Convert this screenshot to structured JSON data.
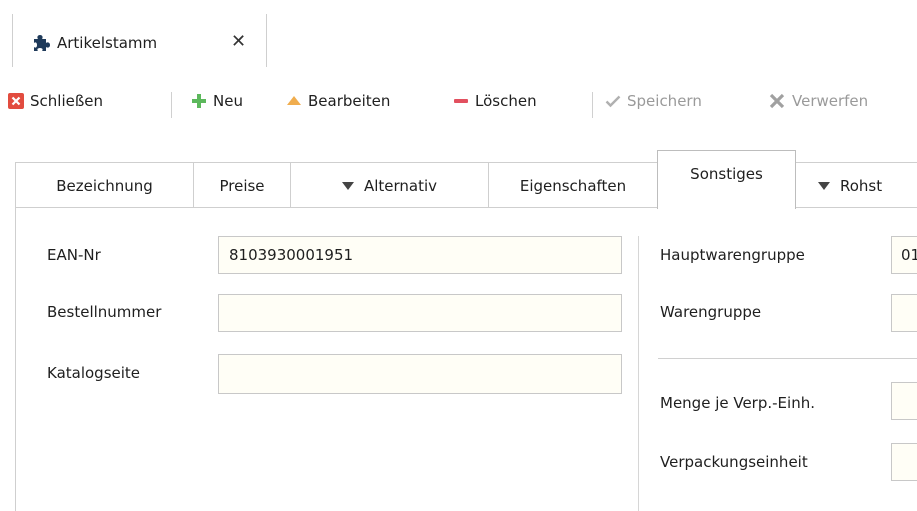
{
  "document_tab": {
    "title": "Artikelstamm",
    "close_glyph": "✕",
    "icon": "puzzle-icon"
  },
  "toolbar": {
    "close_label": "Schließen",
    "new_label": "Neu",
    "edit_label": "Bearbeiten",
    "delete_label": "Löschen",
    "save_label": "Speichern",
    "discard_label": "Verwerfen",
    "colors": {
      "close": "#e24c3f",
      "new": "#5cb85c",
      "edit": "#f0ad4e",
      "delete": "#e2505f",
      "disabled": "#b0b0b0"
    }
  },
  "form_tabs": {
    "bezeichnung": "Bezeichnung",
    "preise": "Preise",
    "alternativ": "Alternativ",
    "eigenschaften": "Eigenschaften",
    "sonstiges": "Sonstiges",
    "rohst": "Rohst",
    "active": "Sonstiges"
  },
  "left_fields": {
    "ean_label": "EAN-Nr",
    "ean_value": "8103930001951",
    "bestell_label": "Bestellnummer",
    "bestell_value": "",
    "katalog_label": "Katalogseite",
    "katalog_value": ""
  },
  "right_fields": {
    "hauptwaren_label": "Hauptwarengruppe",
    "hauptwaren_value": "01",
    "waren_label": "Warengruppe",
    "waren_value": "",
    "menge_label": "Menge je Verp.-Einh.",
    "menge_value": "",
    "verpackung_label": "Verpackungseinheit",
    "verpackung_value": ""
  }
}
